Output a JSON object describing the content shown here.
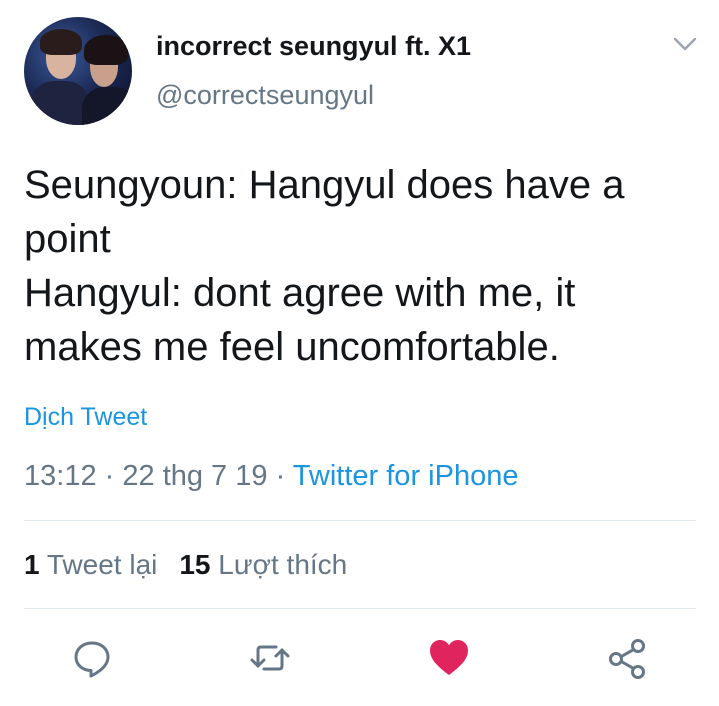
{
  "tweet": {
    "author_name": "incorrect seungyul ft. X1",
    "handle": "@correctseungyul",
    "text_lines": [
      "Seungyoun: Hangyul does have a",
      "point",
      "Hangyul: dont agree with me, it",
      "makes me feel uncomfortable."
    ],
    "translate_label": "Dịch Tweet",
    "time": "13:12",
    "date": "22 thg 7 19",
    "separator": "·",
    "source": "Twitter for iPhone"
  },
  "stats": {
    "retweet_count": "1",
    "retweet_label": "Tweet lại",
    "like_count": "15",
    "like_label": "Lượt thích"
  },
  "icons": {
    "menu": "chevron-down-icon",
    "reply": "reply-icon",
    "retweet": "retweet-icon",
    "like": "heart-icon",
    "share": "share-icon"
  },
  "colors": {
    "link": "#1b95e0",
    "like_active": "#e0245e",
    "secondary_text": "#657786",
    "icon_gray": "#657786"
  }
}
